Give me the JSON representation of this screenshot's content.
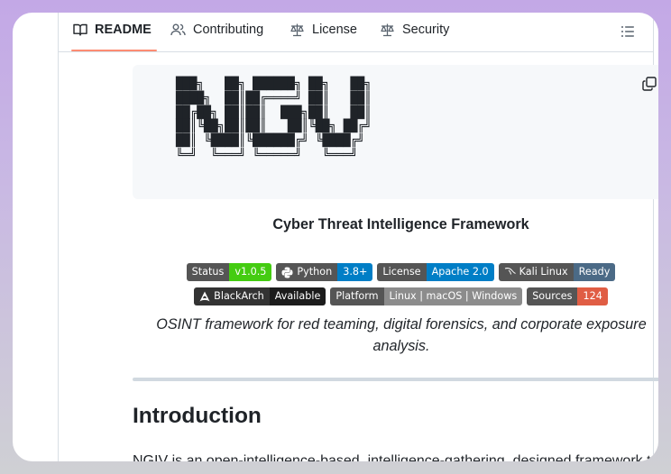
{
  "tabs": [
    {
      "label": "README",
      "icon": "book-icon",
      "active": true
    },
    {
      "label": "Contributing",
      "icon": "people-icon",
      "active": false
    },
    {
      "label": "License",
      "icon": "law-icon",
      "active": false
    },
    {
      "label": "Security",
      "icon": "law-icon",
      "active": false
    }
  ],
  "ascii_logo": "███╗   ██╗ ██████╗ ██╗   ██╗\n████╗  ██║██╔════╝ ██║   ██║\n██╔██╗ ██║██║  ███╗██║   ██║\n██║╚██╗██║██║   ██║╚██╗ ██╔╝\n██║ ╚████║╚██████╔╝ ╚████╔╝ \n╚═╝  ╚═══╝ ╚═════╝   ╚═══╝  ",
  "title": "Cyber Threat Intelligence Framework",
  "badges_row1": [
    {
      "label": "Status",
      "value": "v1.0.5",
      "color": "#4c1"
    },
    {
      "label": "Python",
      "value": "3.8+",
      "color": "#007ec6",
      "icon": "python-icon"
    },
    {
      "label": "License",
      "value": "Apache 2.0",
      "color": "#007ec6"
    },
    {
      "label": "Kali Linux",
      "value": "Ready",
      "color": "#4b6a86",
      "icon": "kali-icon"
    }
  ],
  "badges_row2": [
    {
      "label": "BlackArch",
      "value": "Available",
      "color": "#1c1c1c",
      "icon": "blackarch-icon"
    },
    {
      "label": "Platform",
      "value": "Linux | macOS | Windows",
      "color": "#8c8c8c"
    },
    {
      "label": "Sources",
      "value": "124",
      "color": "#e05d44"
    }
  ],
  "tagline": "OSINT framework for red teaming, digital forensics, and corporate exposure analysis.",
  "intro_heading": "Introduction",
  "intro_cut_text": "NGIV is an open-intelligence-based, intelligence-gathering, designed framework to"
}
